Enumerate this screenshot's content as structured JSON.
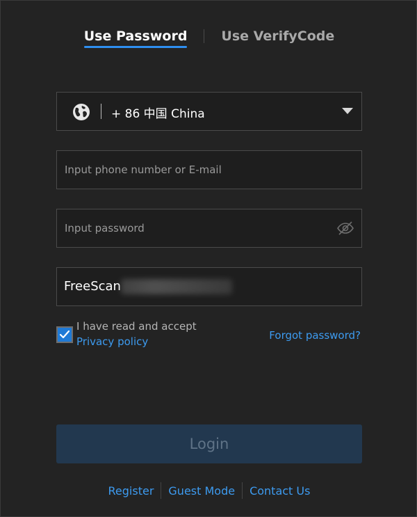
{
  "tabs": {
    "password_label": "Use Password",
    "verifycode_label": "Use VerifyCode"
  },
  "country": {
    "value": "+ 86 中国 China",
    "icon": "globe-icon"
  },
  "phone": {
    "placeholder": "Input phone number or E-mail",
    "value": ""
  },
  "password": {
    "placeholder": "Input password",
    "value": "",
    "visibility_icon": "eye-hidden-icon"
  },
  "account": {
    "prefix": "FreeScan"
  },
  "agree": {
    "checked": true,
    "text": "I have read and accept",
    "privacy_label": "Privacy policy"
  },
  "forgot_label": "Forgot password?",
  "login_label": "Login",
  "footer": {
    "register": "Register",
    "guest": "Guest Mode",
    "contact": "Contact Us"
  },
  "colors": {
    "background": "#232323",
    "accent": "#2e8ff0",
    "link": "#3d9bf0",
    "login_disabled_bg": "#22384f"
  }
}
